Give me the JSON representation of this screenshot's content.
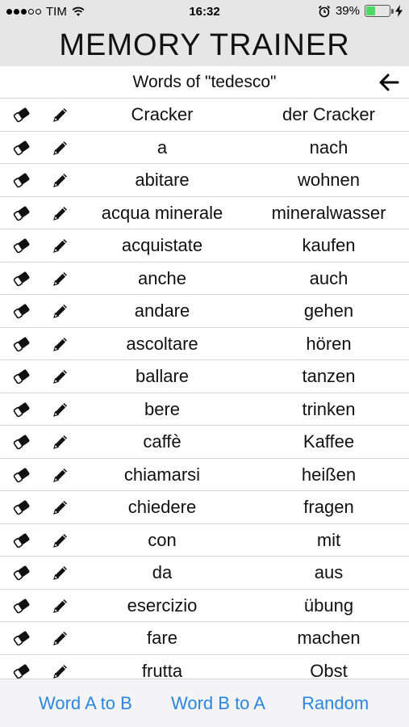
{
  "status_bar": {
    "carrier": "TIM",
    "time": "16:32",
    "battery_percent_text": "39%",
    "battery_level": 0.39,
    "battery_color": "#4cd964"
  },
  "app_title": "MEMORY TRAINER",
  "list_header": {
    "title": "Words of \"tedesco\"",
    "back_icon": "arrow-left-icon"
  },
  "icons": {
    "delete": "eraser-icon",
    "edit": "pencil-icon"
  },
  "words": [
    {
      "a": "Cracker",
      "b": "der Cracker"
    },
    {
      "a": "a",
      "b": "nach"
    },
    {
      "a": "abitare",
      "b": "wohnen"
    },
    {
      "a": "acqua minerale",
      "b": "mineralwasser"
    },
    {
      "a": "acquistate",
      "b": "kaufen"
    },
    {
      "a": "anche",
      "b": "auch"
    },
    {
      "a": "andare",
      "b": "gehen"
    },
    {
      "a": "ascoltare",
      "b": "hören"
    },
    {
      "a": "ballare",
      "b": "tanzen"
    },
    {
      "a": "bere",
      "b": "trinken"
    },
    {
      "a": "caffè",
      "b": "Kaffee"
    },
    {
      "a": "chiamarsi",
      "b": "heißen"
    },
    {
      "a": "chiedere",
      "b": "fragen"
    },
    {
      "a": "con",
      "b": "mit"
    },
    {
      "a": "da",
      "b": "aus"
    },
    {
      "a": "esercizio",
      "b": "übung"
    },
    {
      "a": "fare",
      "b": "machen"
    },
    {
      "a": "frutta",
      "b": "Obst"
    }
  ],
  "tab_bar": {
    "word_a_to_b": "Word A to B",
    "word_b_to_a": "Word B to A",
    "random": "Random",
    "accent_color": "#2a86e0"
  }
}
